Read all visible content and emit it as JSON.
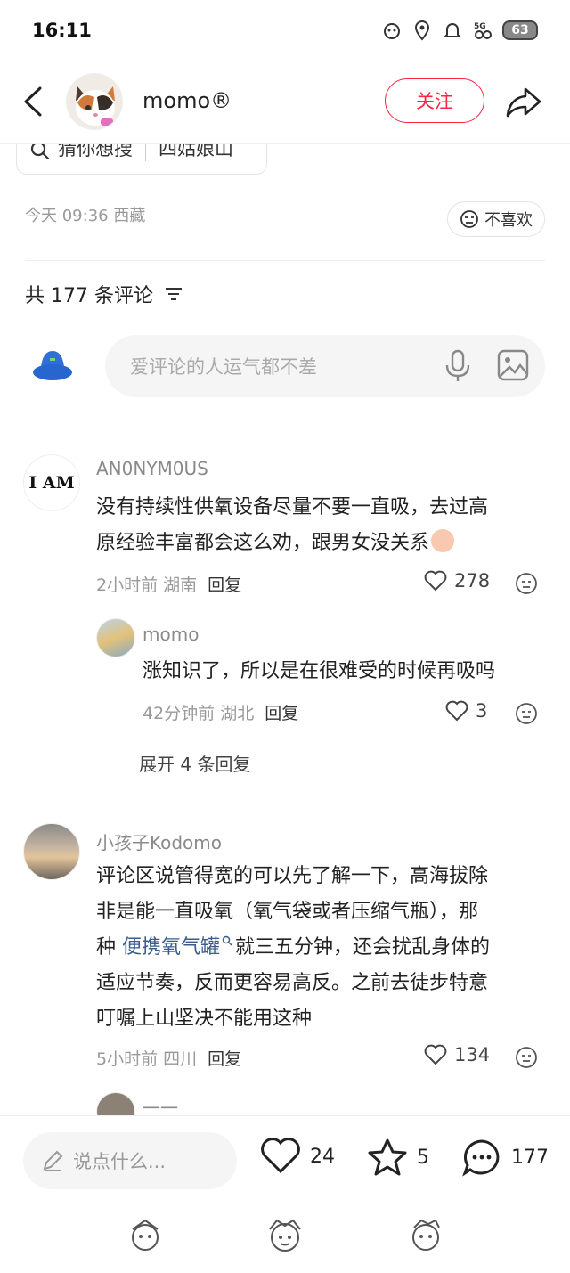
{
  "status": {
    "time": "16:11",
    "battery": "63",
    "network": "5G"
  },
  "header": {
    "username": "momo®",
    "follow_label": "关注"
  },
  "search_tag": {
    "prefix": "猜你想搜",
    "term": "四姑娘山"
  },
  "post_meta": {
    "time_location": "今天 09:36 西藏",
    "dislike_label": "不喜欢"
  },
  "comments_header": {
    "count_text": "共 177 条评论"
  },
  "comment_input": {
    "placeholder": "爱评论的人运气都不差"
  },
  "comments": [
    {
      "avatar_text": "I AM",
      "name": "AN0NYM0US",
      "text_line1": "没有持续性供氧设备尽量不要一直吸，去过高",
      "text_line2": "原经验丰富都会这么劝，跟男女没关系",
      "meta": "2小时前 湖南",
      "reply_label": "回复",
      "likes": "278",
      "reply": {
        "name": "momo",
        "text": "涨知识了，所以是在很难受的时候再吸吗",
        "meta": "42分钟前 湖北",
        "reply_label": "回复",
        "likes": "3"
      },
      "expand_label": "展开 4 条回复"
    },
    {
      "name": "小孩子Kodomo",
      "text_line1": "评论区说管得宽的可以先了解一下，高海拔除",
      "text_line2": "非是能一直吸氧（氧气袋或者压缩气瓶），那",
      "text_line3_prefix": "种",
      "text_line3_link": "便携氧气罐",
      "text_line3_suffix": "就三五分钟，还会扰乱身体的",
      "text_line4": "适应节奏，反而更容易高反。之前去徒步特意",
      "text_line5": "叮嘱上山坚决不能用这种",
      "meta": "5小时前 四川",
      "reply_label": "回复",
      "likes": "134",
      "next_reply_name": "一一"
    }
  ],
  "bottom_bar": {
    "say_placeholder": "说点什么...",
    "like_count": "24",
    "star_count": "5",
    "comment_count": "177"
  }
}
